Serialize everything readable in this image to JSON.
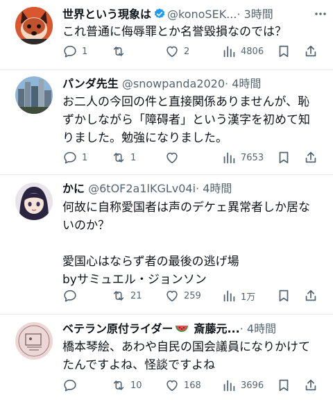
{
  "tweets": [
    {
      "name": "世界という現象は",
      "handle": "@konoSEK...",
      "time": "· 3時間",
      "verified": true,
      "avatar_icon": "shiba-dog-avatar",
      "text": "これ普通に侮辱罪とか名誉毀損なのでは？",
      "replies": "1",
      "reposts": "",
      "likes": "2",
      "views": "4806"
    },
    {
      "name": "パンダ先生",
      "handle": "@snowpanda2020",
      "time": "· 4時間",
      "verified": false,
      "avatar_icon": "city-skyline-avatar",
      "text": "お二人の今回の件と直接関係ありませんが、恥ずかしながら「障碍者」という漢字を初めて知りました。勉強になりました。",
      "replies": "1",
      "reposts": "1",
      "likes": "",
      "views": "7653"
    },
    {
      "name": "かに",
      "handle": "@6tOF2a1lKGLv04i",
      "time": "· 4時間",
      "verified": false,
      "avatar_icon": "anime-girl-avatar",
      "text": "何故に自称愛国者は声のデケェ異常者しか居ないのか？\n\n愛国心はならず者の最後の逃げ場\nbyサミュエル・ジョンソン",
      "replies": "",
      "reposts": "21",
      "likes": "259",
      "views": "1万"
    },
    {
      "name": "ベテラン原付ライダー",
      "name_suffix": "斎藤元...",
      "time": "· 4時間",
      "verified": false,
      "avatar_icon": "sketch-avatar",
      "text": "橋本琴絵、あわや自民の国会議員になりかけてたんですよね、怪談ですよね",
      "replies": "",
      "reposts": "10",
      "likes": "168",
      "views": "3696"
    }
  ],
  "colors": {
    "text": "#0f1419",
    "muted": "#536471",
    "verified": "#1d9bf0",
    "divider": "#e6e9ec"
  }
}
